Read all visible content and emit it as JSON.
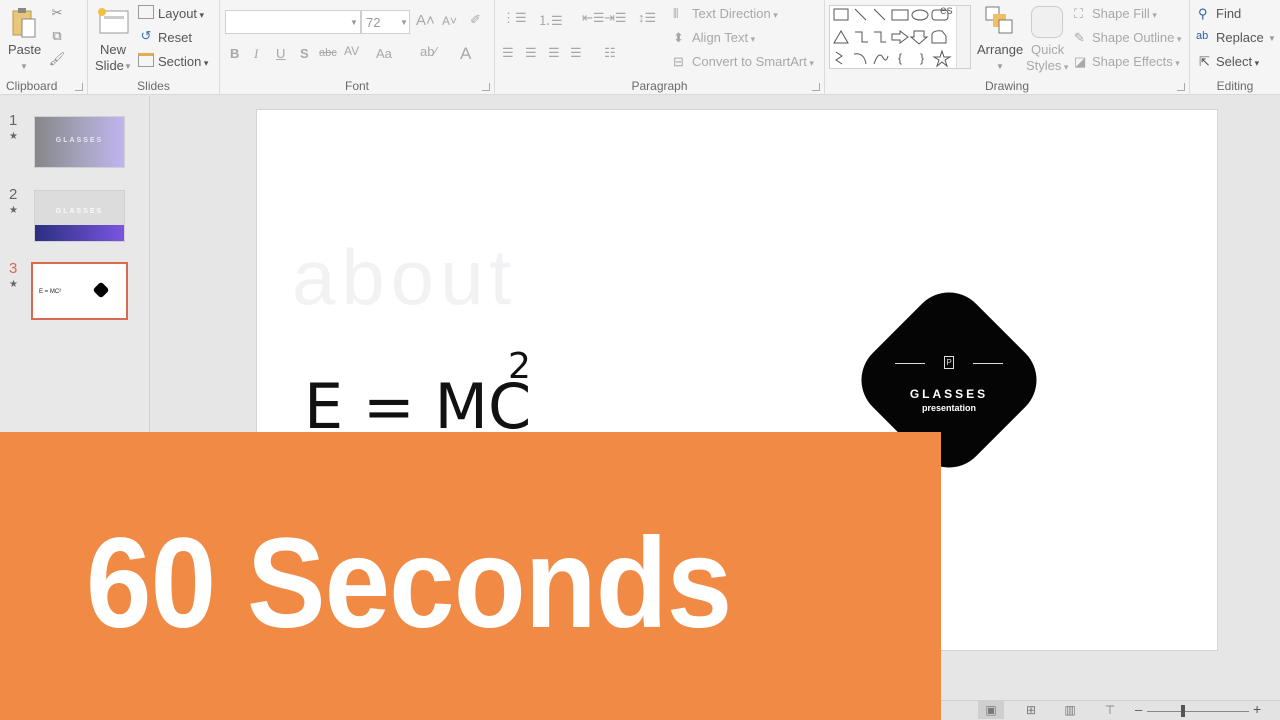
{
  "ribbon": {
    "clipboard": {
      "label": "Clipboard",
      "paste": "Paste"
    },
    "slides": {
      "label": "Slides",
      "new_slide_line1": "New",
      "new_slide_line2": "Slide",
      "layout": "Layout",
      "reset": "Reset",
      "section": "Section"
    },
    "font": {
      "label": "Font",
      "font_name": "",
      "font_size": "72",
      "bold": "B",
      "italic": "I",
      "underline": "U",
      "shadow": "S",
      "strikethrough": "abc",
      "spacing": "AV",
      "change_case": "Aa",
      "font_color": "A"
    },
    "paragraph": {
      "label": "Paragraph",
      "text_direction": "Text Direction",
      "align_text": "Align Text",
      "convert_smartart": "Convert to SmartArt"
    },
    "drawing": {
      "label": "Drawing",
      "arrange": "Arrange",
      "quick_styles_line1": "Quick",
      "quick_styles_line2": "Styles",
      "shape_fill": "Shape Fill",
      "shape_outline": "Shape Outline",
      "shape_effects": "Shape Effects"
    },
    "editing": {
      "label": "Editing",
      "find": "Find",
      "replace": "Replace",
      "select": "Select"
    }
  },
  "thumbnails": [
    {
      "number": "1",
      "title": "GLASSES",
      "selected": false
    },
    {
      "number": "2",
      "title": "GLASSES",
      "selected": false
    },
    {
      "number": "3",
      "title": "E = MC²",
      "selected": true
    }
  ],
  "slide": {
    "heading": "about",
    "formula": "E = MC",
    "exponent": "2",
    "badge_title": "GLASSES",
    "badge_subtitle": "presentation"
  },
  "statusbar": {
    "notes_fragment": "es",
    "zoom_level_fraction": 0.35
  },
  "overlay": {
    "text": "60 Seconds",
    "color": "#f08a45"
  },
  "colors": {
    "selected_thumb_border": "#d66b52"
  }
}
